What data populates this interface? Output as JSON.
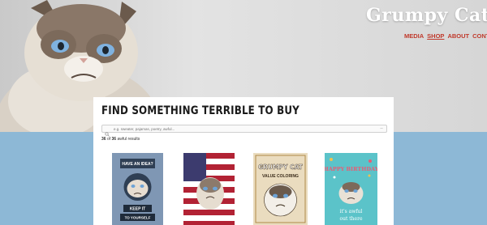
{
  "brand": {
    "logo_text": "Grumpy Cat"
  },
  "nav": {
    "items": [
      {
        "label": "MEDIA"
      },
      {
        "label": "SHOP",
        "active": true
      },
      {
        "label": "ABOUT"
      },
      {
        "label": "CONTACT"
      }
    ]
  },
  "shop": {
    "title": "FIND SOMETHING TERRIBLE TO BUY",
    "search_placeholder": "e.g. sweater, pajamas, poetry, awful...",
    "results": {
      "shown": "36",
      "of": "of",
      "total": "36",
      "suffix": "awful results"
    }
  },
  "products": [
    {
      "image_text": [
        "HAVE AN IDEA?",
        "KEEP IT",
        "TO YOURSELF"
      ],
      "icon": "keep-it-to-yourself-poster"
    },
    {
      "image_text": [],
      "icon": "american-flag-cat-poster"
    },
    {
      "image_text": [
        "GRUMPY CAT",
        "VALUE COLORING"
      ],
      "icon": "coloring-book-cover"
    },
    {
      "image_text": [
        "HAPPY BIRTHDAY",
        "it's awful",
        "out there"
      ],
      "icon": "birthday-card"
    }
  ],
  "colors": {
    "accent_red": "#c0392b",
    "band_blue": "#8db8d6",
    "logo_white": "#ffffff"
  }
}
